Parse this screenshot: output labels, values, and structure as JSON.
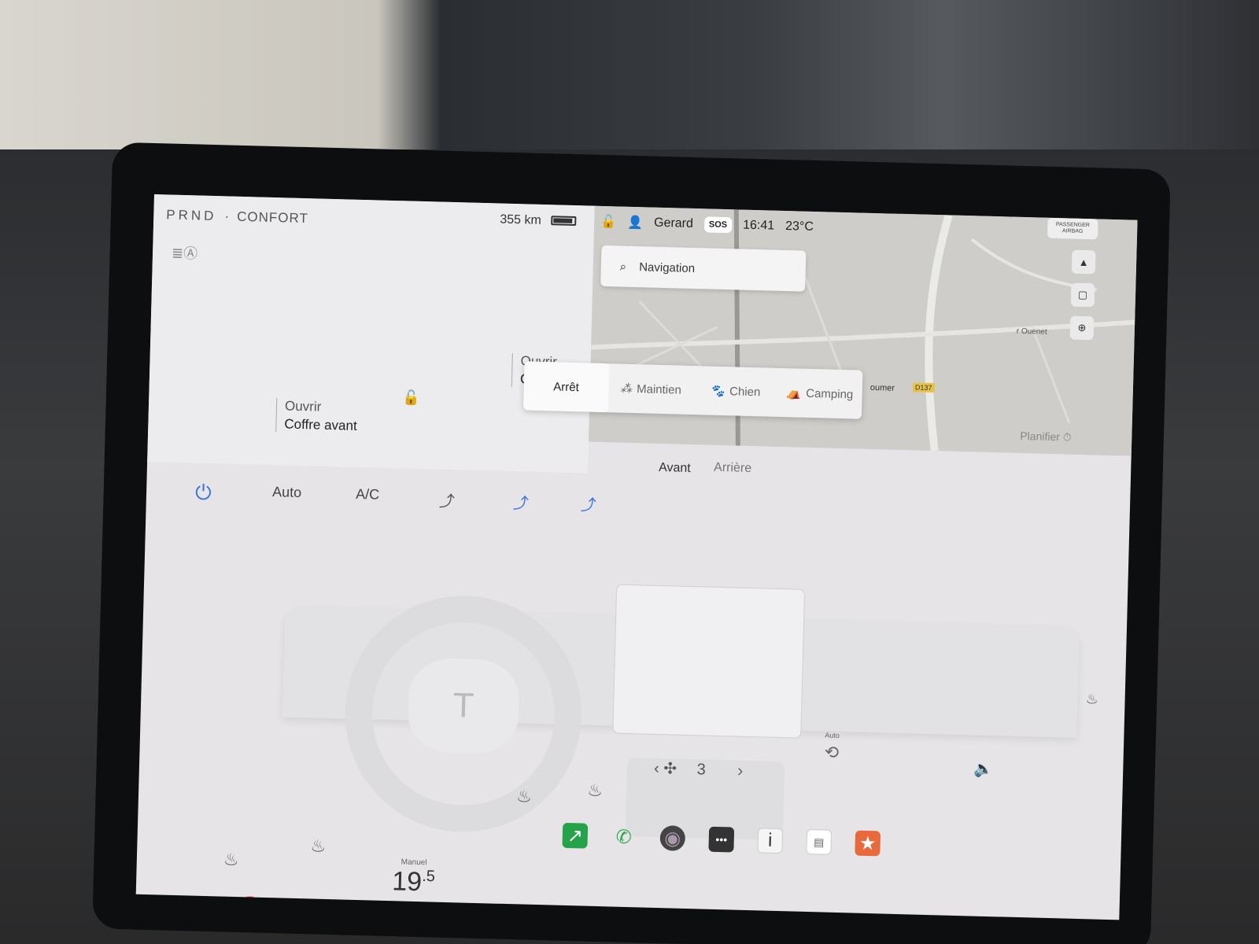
{
  "status": {
    "gears": "PRND",
    "drive_mode": "CONFORT",
    "range": "355 km",
    "user": "Gerard",
    "sos_label": "SOS",
    "time": "16:41",
    "outside_temp": "23°C",
    "airbag_label": "PASSENGER AIRBAG"
  },
  "navigation": {
    "search_placeholder": "Navigation",
    "map_labels": [
      "oumer",
      "D137",
      "r Ouenet"
    ]
  },
  "openers": {
    "front": {
      "action": "Ouvrir",
      "target": "Coffre avant"
    },
    "rear": {
      "action": "Ouvrir",
      "target": "Co"
    }
  },
  "climate_keeper": {
    "options": [
      "Arrêt",
      "Maintien",
      "Chien",
      "Camping"
    ],
    "selected": "Arrêt",
    "schedule_label": "Planifier"
  },
  "climate": {
    "auto_label": "Auto",
    "ac_label": "A/C",
    "zones": [
      "Avant",
      "Arrière"
    ],
    "active_zone": "Avant",
    "fan_speed": "3",
    "small_auto_label": "Auto",
    "temp_mode": "Manuel",
    "temp_value": "19",
    "temp_decimal": ".5"
  },
  "icons": {
    "power": "power-icon",
    "headlight": "auto-headlight-icon",
    "lock": "unlock-icon",
    "fan": "fan-icon",
    "seat_heat": "seat-heat-icon",
    "steering_heat": "steering-heat-icon",
    "volume": "volume-icon",
    "car": "car-icon"
  },
  "dock": [
    "energy-app-icon",
    "phone-icon",
    "camera-icon",
    "more-icon",
    "manual-icon",
    "calendar-icon",
    "toybox-icon"
  ],
  "colors": {
    "accent_blue": "#3b72e0",
    "phone_green": "#2aa84a",
    "energy_green": "#25a24a"
  }
}
